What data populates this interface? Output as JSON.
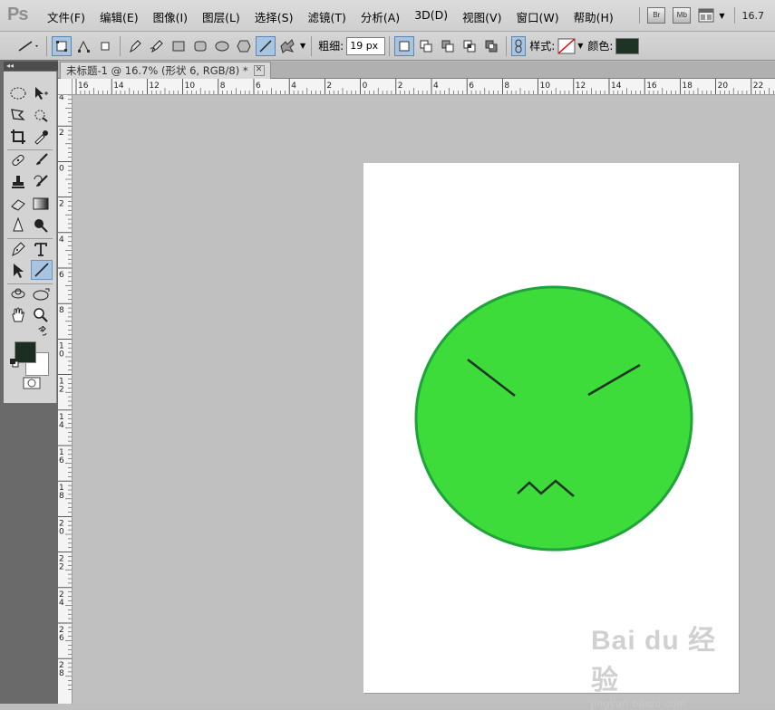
{
  "app": {
    "logo": "Ps",
    "zoom": "16.7"
  },
  "menu": [
    "文件(F)",
    "编辑(E)",
    "图像(I)",
    "图层(L)",
    "选择(S)",
    "滤镜(T)",
    "分析(A)",
    "3D(D)",
    "视图(V)",
    "窗口(W)",
    "帮助(H)"
  ],
  "menubar_buttons": {
    "bridge": "Br",
    "minibridge": "Mb"
  },
  "options": {
    "weight_label": "粗细:",
    "weight_value": "19 px",
    "style_label": "样式:",
    "color_label": "颜色:",
    "color": "#1d3323"
  },
  "document": {
    "tab_title": "未标题-1 @ 16.7% (形状 6, RGB/8) *",
    "close": "✕"
  },
  "rulers": {
    "horizontal_labels": [
      "16",
      "14",
      "12",
      "10",
      "8",
      "6",
      "4",
      "2",
      "0",
      "2",
      "4",
      "6",
      "8",
      "10",
      "12",
      "14",
      "16",
      "18",
      "20",
      "22"
    ],
    "vertical_labels": [
      "4",
      "2",
      "0",
      "2",
      "4",
      "6",
      "8",
      "10",
      "12",
      "14",
      "16",
      "18",
      "20",
      "22",
      "24",
      "26",
      "28"
    ]
  },
  "colors": {
    "foreground": "#1c2e22",
    "background": "#ffffff",
    "face_fill": "#3ddc3a",
    "face_stroke": "#1fa33a",
    "feature_stroke": "#1d3323",
    "tool_active": "#a7c4e0"
  },
  "watermark": {
    "main": "Bai du 经验",
    "sub": "jingyan.baidu.com"
  }
}
